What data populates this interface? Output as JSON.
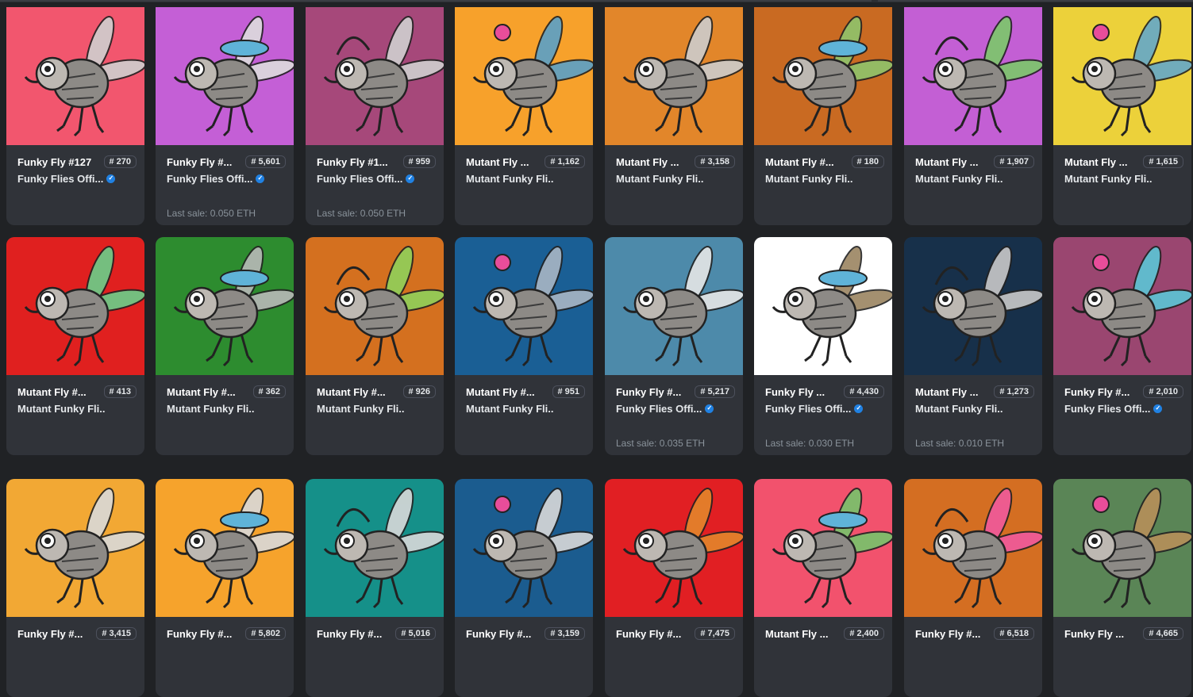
{
  "colors": {
    "page_bg": "#202225",
    "card_bg": "#303339",
    "muted_text": "#8a939b",
    "verified_blue": "#2081e2"
  },
  "sale_label": "Last sale:",
  "hash_symbol": "#",
  "verified_icon": "check-badge-icon",
  "cards": [
    {
      "name": "Funky Fly #127",
      "rank": "270",
      "collection": "Funky Flies Offi...",
      "verified": true,
      "last_sale": "",
      "bg": "#f2566e",
      "wing": "#cfcfcf"
    },
    {
      "name": "Funky Fly #...",
      "rank": "5,601",
      "collection": "Funky Flies Offi...",
      "verified": true,
      "last_sale": "0.050 ETH",
      "bg": "#c45fd6",
      "wing": "#dddddd"
    },
    {
      "name": "Funky Fly #1...",
      "rank": "959",
      "collection": "Funky Flies Offi...",
      "verified": true,
      "last_sale": "0.050 ETH",
      "bg": "#a6487a",
      "wing": "#d0d0d0"
    },
    {
      "name": "Mutant Fly ...",
      "rank": "1,162",
      "collection": "Mutant Funky Fli...",
      "verified": false,
      "last_sale": "",
      "bg": "#f7a12b",
      "wing": "#5aa0c8"
    },
    {
      "name": "Mutant Fly ...",
      "rank": "3,158",
      "collection": "Mutant Funky Fli...",
      "verified": false,
      "last_sale": "",
      "bg": "#e2862a",
      "wing": "#cccccc"
    },
    {
      "name": "Mutant Fly #...",
      "rank": "180",
      "collection": "Mutant Funky Fli...",
      "verified": false,
      "last_sale": "",
      "bg": "#c96a22",
      "wing": "#8fc46c"
    },
    {
      "name": "Mutant Fly ...",
      "rank": "1,907",
      "collection": "Mutant Funky Fli...",
      "verified": false,
      "last_sale": "",
      "bg": "#c35fd4",
      "wing": "#7bc96a"
    },
    {
      "name": "Mutant Fly ...",
      "rank": "1,615",
      "collection": "Mutant Funky Fli...",
      "verified": false,
      "last_sale": "",
      "bg": "#ecd13a",
      "wing": "#64a9c9"
    },
    {
      "name": "Mutant Fly #...",
      "rank": "413",
      "collection": "Mutant Funky Fli...",
      "verified": false,
      "last_sale": "",
      "bg": "#e0201f",
      "wing": "#6ad08a"
    },
    {
      "name": "Mutant Fly #...",
      "rank": "362",
      "collection": "Mutant Funky Fli...",
      "verified": false,
      "last_sale": "",
      "bg": "#2d8c2f",
      "wing": "#b8b8b8"
    },
    {
      "name": "Mutant Fly #...",
      "rank": "926",
      "collection": "Mutant Funky Fli...",
      "verified": false,
      "last_sale": "",
      "bg": "#d4701f",
      "wing": "#8fd15a"
    },
    {
      "name": "Mutant Fly #...",
      "rank": "951",
      "collection": "Mutant Funky Fli...",
      "verified": false,
      "last_sale": "",
      "bg": "#1a5f95",
      "wing": "#a9b6c4"
    },
    {
      "name": "Funky Fly #...",
      "rank": "5,217",
      "collection": "Funky Flies Offi...",
      "verified": true,
      "last_sale": "0.035 ETH",
      "bg": "#4d8aaa",
      "wing": "#e6e6e6"
    },
    {
      "name": "Funky Fly ...",
      "rank": "4,430",
      "collection": "Funky Flies Offi...",
      "verified": true,
      "last_sale": "0.030 ETH",
      "bg": "#ffffff",
      "wing": "#9b8461"
    },
    {
      "name": "Mutant Fly ...",
      "rank": "1,273",
      "collection": "Mutant Funky Fli...",
      "verified": false,
      "last_sale": "0.010 ETH",
      "bg": "#17304a",
      "wing": "#c9c9c9"
    },
    {
      "name": "Funky Fly #...",
      "rank": "2,010",
      "collection": "Funky Flies Offi...",
      "verified": true,
      "last_sale": "",
      "bg": "#9a4670",
      "wing": "#5bc6d6"
    },
    {
      "name": "Funky Fly #...",
      "rank": "3,415",
      "collection": "",
      "verified": false,
      "last_sale": "",
      "bg": "#f2a834",
      "wing": "#d9d9d9"
    },
    {
      "name": "Funky Fly #...",
      "rank": "5,802",
      "collection": "",
      "verified": false,
      "last_sale": "",
      "bg": "#f6a32c",
      "wing": "#d9d9d9"
    },
    {
      "name": "Funky Fly #...",
      "rank": "5,016",
      "collection": "",
      "verified": false,
      "last_sale": "",
      "bg": "#159089",
      "wing": "#d9d9d9"
    },
    {
      "name": "Funky Fly #...",
      "rank": "3,159",
      "collection": "",
      "verified": false,
      "last_sale": "",
      "bg": "#1b5c8f",
      "wing": "#d9d9d9"
    },
    {
      "name": "Funky Fly #...",
      "rank": "7,475",
      "collection": "",
      "verified": false,
      "last_sale": "",
      "bg": "#e11f23",
      "wing": "#e4862b"
    },
    {
      "name": "Mutant Fly ...",
      "rank": "2,400",
      "collection": "",
      "verified": false,
      "last_sale": "",
      "bg": "#f2526d",
      "wing": "#76c56b"
    },
    {
      "name": "Funky Fly #...",
      "rank": "6,518",
      "collection": "",
      "verified": false,
      "last_sale": "",
      "bg": "#d46e22",
      "wing": "#f05a9c"
    },
    {
      "name": "Funky Fly ...",
      "rank": "4,665",
      "collection": "",
      "verified": false,
      "last_sale": "",
      "bg": "#5a8556",
      "wing": "#b78f5a"
    }
  ]
}
